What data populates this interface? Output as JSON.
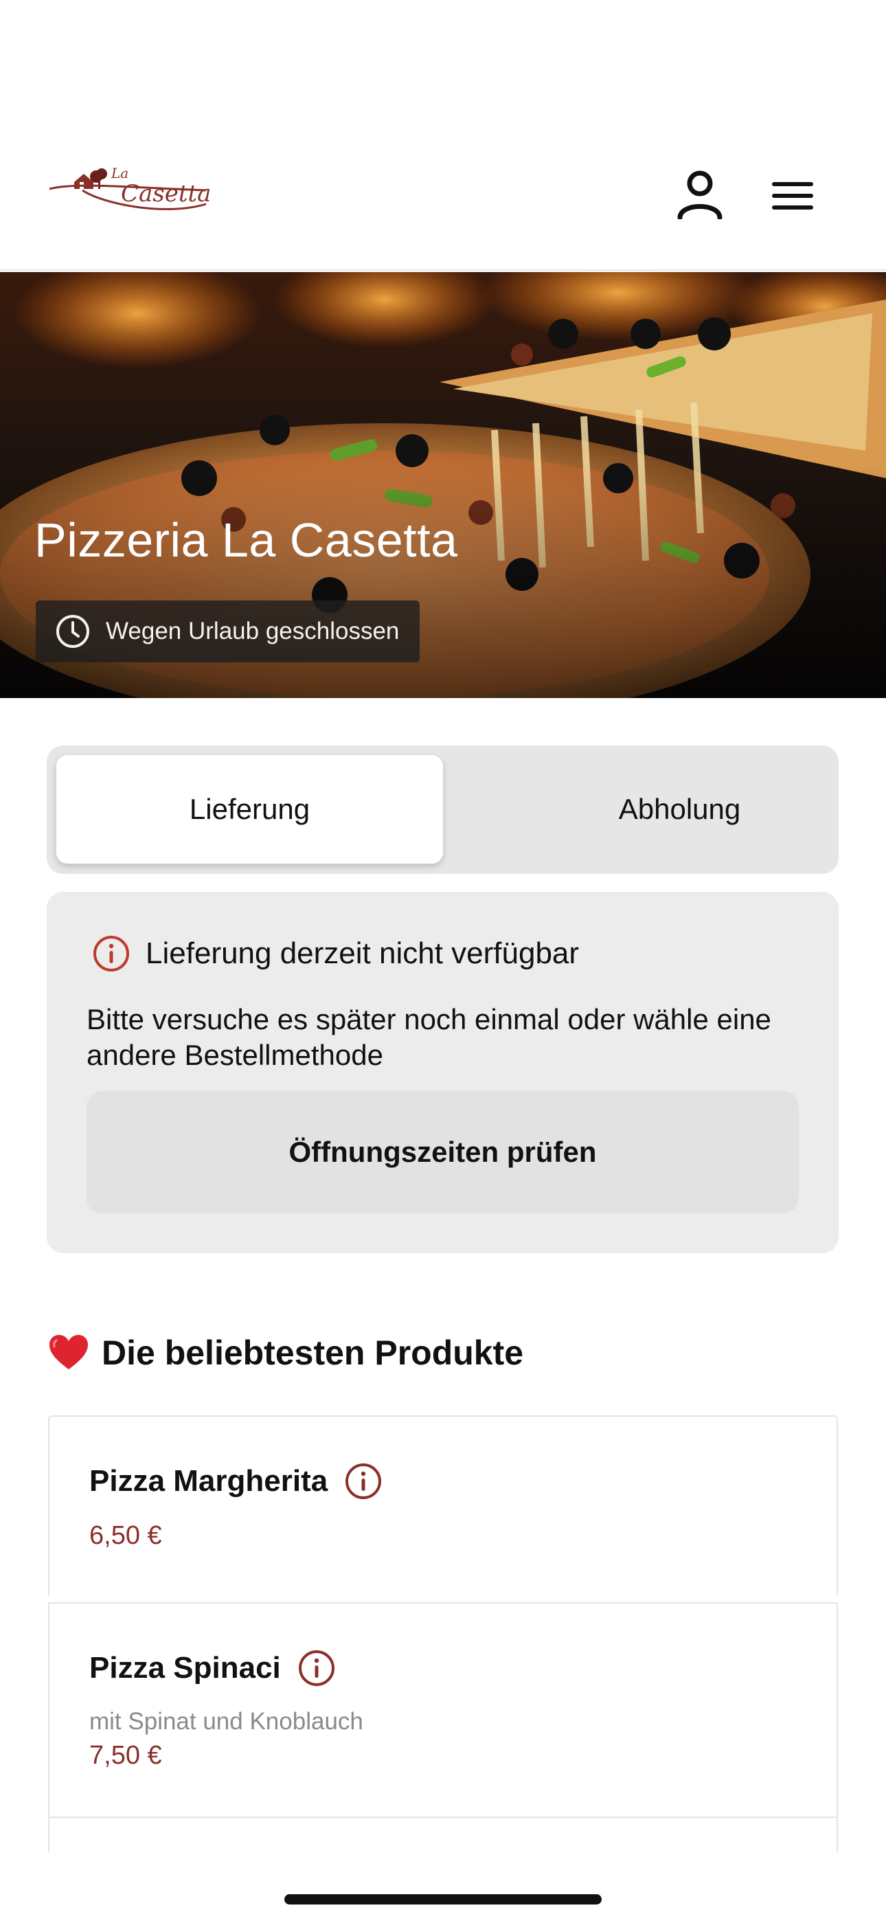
{
  "header": {
    "logo_top": "La",
    "logo_bottom": "Casetta"
  },
  "hero": {
    "title": "Pizzeria La Casetta",
    "status": "Wegen Urlaub geschlossen"
  },
  "order_method": {
    "options": [
      {
        "label": "Lieferung",
        "selected": true
      },
      {
        "label": "Abholung",
        "selected": false
      }
    ]
  },
  "notice": {
    "title": "Lieferung derzeit nicht verfügbar",
    "text": "Bitte versuche es später noch einmal oder wähle eine andere Bestellmethode",
    "button_label": "Öffnungszeiten prüfen"
  },
  "popular": {
    "title": "Die beliebtesten Produkte",
    "icon": "heart-icon",
    "items": [
      {
        "name": "Pizza Margherita",
        "description": "",
        "price": "6,50 €"
      },
      {
        "name": "Pizza Spinaci",
        "description": "mit Spinat und Knoblauch",
        "price": "7,50 €"
      }
    ]
  },
  "colors": {
    "accent": "#8b2f2a",
    "info_icon": "#c0392b",
    "heart": "#e0242f"
  }
}
